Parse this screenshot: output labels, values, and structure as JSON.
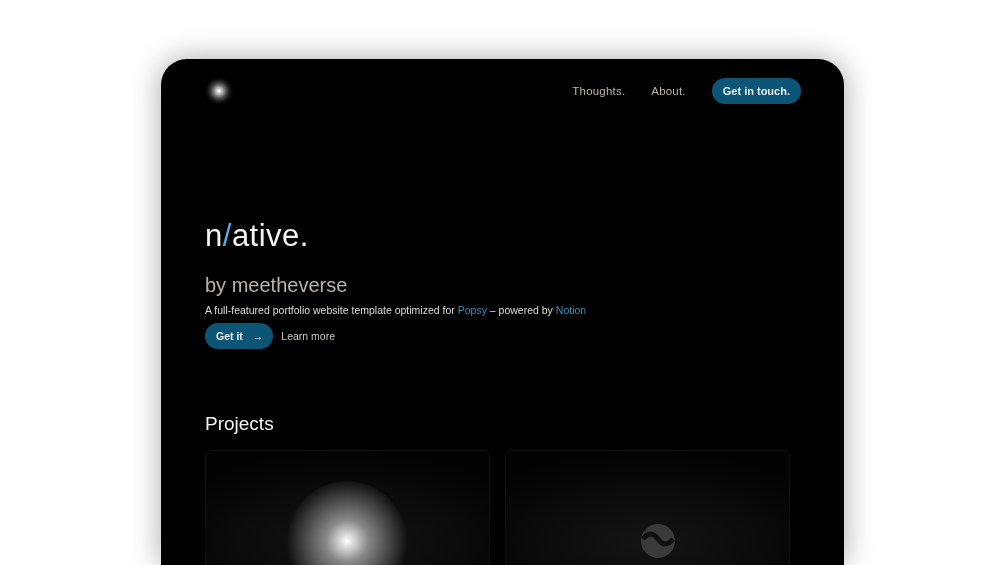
{
  "nav": {
    "links": [
      "Thoughts.",
      "About."
    ],
    "cta": "Get in touch."
  },
  "hero": {
    "title": {
      "before": "n",
      "accent": "/",
      "after": "ative."
    },
    "subtitle": "by meetheverse",
    "description": [
      {
        "kind": "text",
        "text": "A full-featured portfolio website template optimized for "
      },
      {
        "kind": "link",
        "text": "Popsy"
      },
      {
        "kind": "text",
        "text": " – powered by "
      },
      {
        "kind": "link",
        "text": "Notion"
      }
    ],
    "primary_button": {
      "label": "Get it",
      "icon": "→"
    },
    "secondary_link": "Learn more"
  },
  "projects": {
    "heading": "Projects"
  }
}
